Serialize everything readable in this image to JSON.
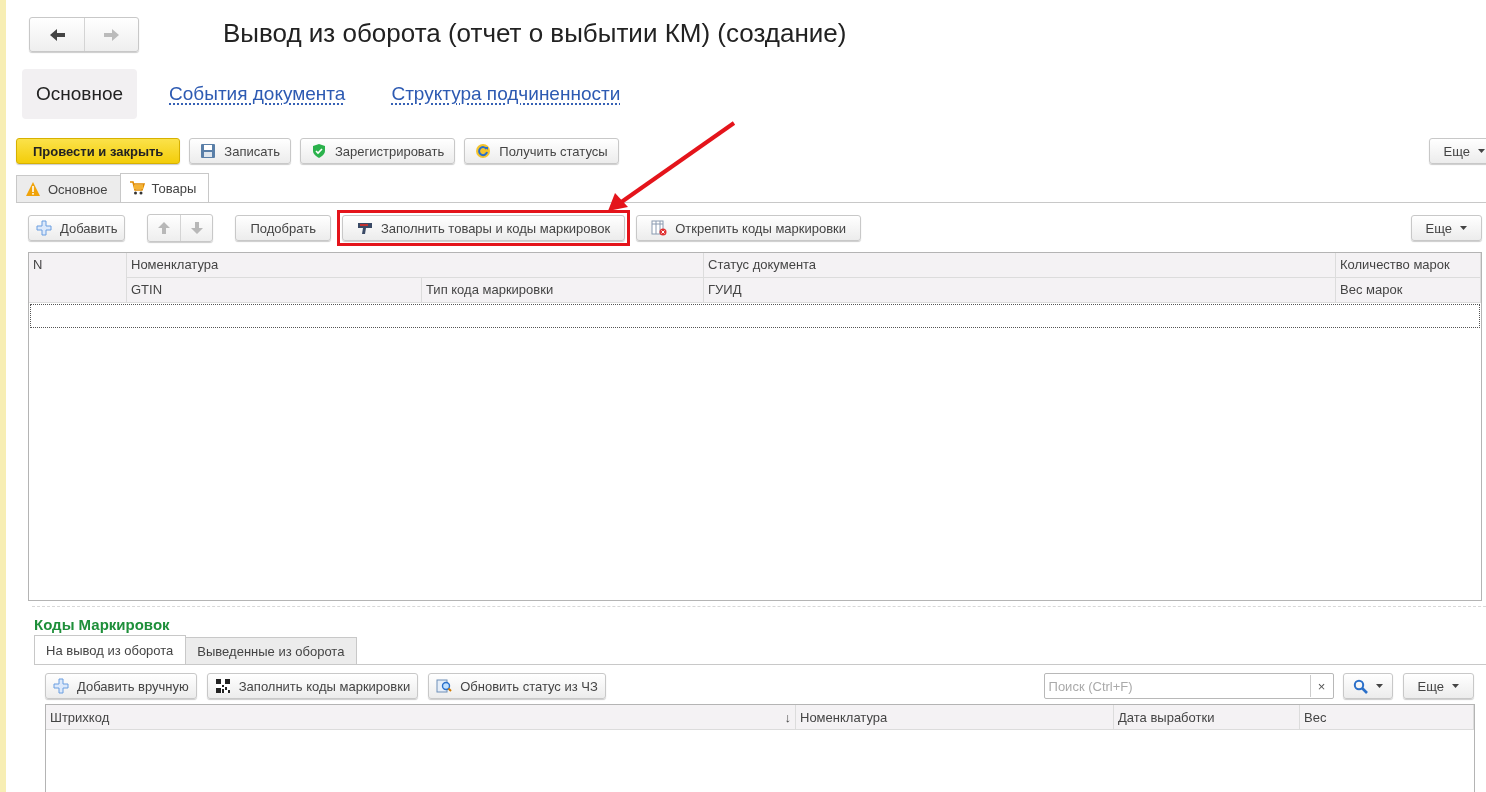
{
  "navigation": {
    "back_enabled": true,
    "forward_enabled": false
  },
  "title": "Вывод из оборота (отчет о выбытии КМ) (создание)",
  "form_sections": [
    {
      "label": "Основное",
      "selected": true
    },
    {
      "label": "События документа",
      "selected": false
    },
    {
      "label": "Структура подчиненности",
      "selected": false
    }
  ],
  "command_bar": {
    "buttons": [
      {
        "label": "Провести и закрыть",
        "kind": "primary"
      },
      {
        "label": "Записать",
        "kind": "normal"
      },
      {
        "label": "Зарегистрировать",
        "kind": "normal"
      },
      {
        "label": "Получить статусы",
        "kind": "normal"
      }
    ],
    "more": "Еще"
  },
  "tabs": [
    {
      "label": "Основное",
      "selected": false
    },
    {
      "label": "Товары",
      "selected": true
    }
  ],
  "goods_toolbar": {
    "buttons": [
      {
        "label": "Добавить",
        "highlighted": false
      },
      {
        "label": "Подобрать",
        "highlighted": false
      },
      {
        "label": "Заполнить товары и коды маркировок",
        "highlighted": true
      },
      {
        "label": "Открепить коды маркировки",
        "highlighted": false
      }
    ],
    "more": "Еще"
  },
  "goods_table": {
    "columns": {
      "n": "N",
      "top": [
        "Номенклатура",
        "Статус документа",
        "Количество марок"
      ],
      "bottom": [
        "GTIN",
        "Тип кода маркировки",
        "ГУИД",
        "Вес марок"
      ]
    }
  },
  "codes": {
    "title": "Коды Маркировок",
    "tabs": [
      {
        "label": "На вывод из оборота",
        "selected": true
      },
      {
        "label": "Выведенные из оборота",
        "selected": false
      }
    ],
    "buttons": [
      {
        "label": "Добавить вручную"
      },
      {
        "label": "Заполнить коды маркировки"
      },
      {
        "label": "Обновить статус из ЧЗ"
      }
    ],
    "search": {
      "placeholder": "Поиск (Ctrl+F)",
      "clear": "×"
    },
    "more": "Еще",
    "columns": [
      {
        "label": "Штрихкод",
        "sort": "↓"
      },
      {
        "label": "Номенклатура"
      },
      {
        "label": "Дата выработки"
      },
      {
        "label": "Вес"
      }
    ]
  }
}
